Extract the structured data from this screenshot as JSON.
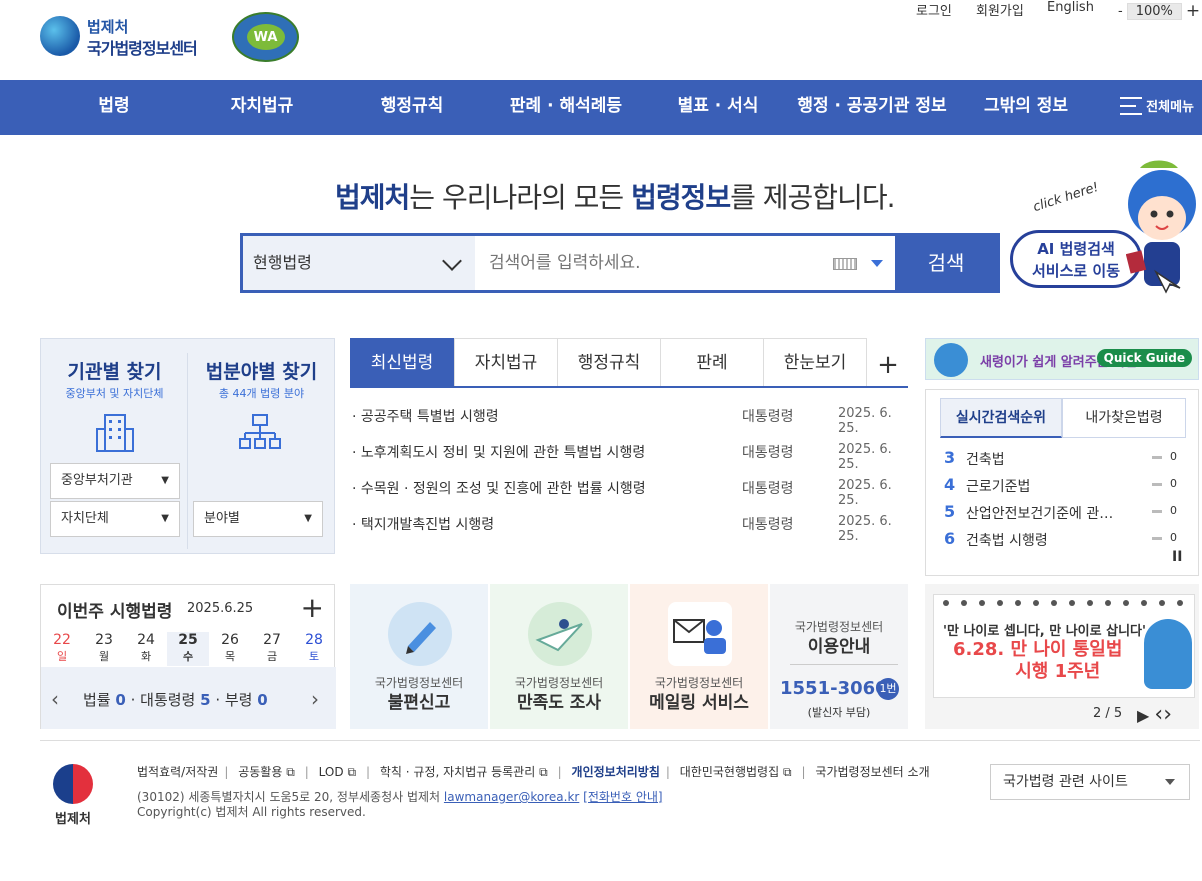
{
  "header": {
    "logo_small": "법제처",
    "logo_main": "국가법령정보센터",
    "wa_mark": "WA",
    "util": {
      "login": "로그인",
      "join": "회원가입",
      "english": "English"
    },
    "zoom": {
      "minus": "-",
      "value": "100%",
      "plus": "+"
    }
  },
  "nav": {
    "items": [
      "법령",
      "자치법규",
      "행정규칙",
      "판례 · 해석례등",
      "별표 · 서식",
      "행정 · 공공기관 정보",
      "그밖의 정보"
    ],
    "all_menu": "전체메뉴"
  },
  "hero": {
    "title_b1": "법제처",
    "title_m1": "는 우리나라의 모든 ",
    "title_b2": "법령정보",
    "title_m2": "를 제공합니다.",
    "search": {
      "select_value": "현행법령",
      "placeholder": "검색어를 입력하세요.",
      "button": "검색"
    },
    "ai_line1": "AI 법령검색",
    "ai_line2": "서비스로 이동",
    "click_here": "click here!"
  },
  "finder": {
    "org": {
      "title": "기관별 찾기",
      "sub": "중앙부처 및 자치단체",
      "dd1": "중앙부처기관",
      "dd2": "자치단체"
    },
    "field": {
      "title": "법분야별 찾기",
      "sub": "총 44개 법령 분야",
      "dd1": "분야별"
    }
  },
  "tabs": {
    "items": [
      "최신법령",
      "자치법규",
      "행정규칙",
      "판례",
      "한눈보기"
    ],
    "active": 0,
    "plus": "+"
  },
  "news": [
    {
      "title": "· 공공주택 특별법 시행령",
      "category": "대통령령",
      "date": "2025. 6. 25."
    },
    {
      "title": "· 노후계획도시 정비 및 지원에 관한 특별법 시행령",
      "category": "대통령령",
      "date": "2025. 6. 25."
    },
    {
      "title": "· 수목원 · 정원의 조성 및 진흥에 관한 법률 시행령",
      "category": "대통령령",
      "date": "2025. 6. 25."
    },
    {
      "title": "· 택지개발촉진법 시행령",
      "category": "대통령령",
      "date": "2025. 6. 25."
    }
  ],
  "quick_guide": {
    "text": "새령이가 쉽게 알려주는 국법",
    "pill": "Quick Guide"
  },
  "rank": {
    "tabs": [
      "실시간검색순위",
      "내가찾은법령"
    ],
    "items": [
      {
        "n": "3",
        "label": "건축법",
        "change": "0"
      },
      {
        "n": "4",
        "label": "근로기준법",
        "change": "0"
      },
      {
        "n": "5",
        "label": "산업안전보건기준에 관한 규칙",
        "change": "0"
      },
      {
        "n": "6",
        "label": "건축법 시행령",
        "change": "0"
      }
    ],
    "pause": "II"
  },
  "week": {
    "title": "이번주 시행법령",
    "date": "2025.6.25",
    "plus": "+",
    "days": [
      {
        "d": "22",
        "w": "일"
      },
      {
        "d": "23",
        "w": "월"
      },
      {
        "d": "24",
        "w": "화"
      },
      {
        "d": "25",
        "w": "수"
      },
      {
        "d": "26",
        "w": "목"
      },
      {
        "d": "27",
        "w": "금"
      },
      {
        "d": "28",
        "w": "토"
      }
    ],
    "sum": {
      "law_label": "법률",
      "law": "0",
      "dec_label": "대통령령",
      "dec": "5",
      "min_label": "부령",
      "min": "0"
    },
    "prev": "‹",
    "next": "›"
  },
  "cards": [
    {
      "l1": "국가법령정보센터",
      "l2": "불편신고"
    },
    {
      "l1": "국가법령정보센터",
      "l2": "만족도 조사"
    },
    {
      "l1": "국가법령정보센터",
      "l2": "메일링 서비스"
    },
    {
      "l1": "국가법령정보센터",
      "l2": "이용안내",
      "phone": "1551-3060",
      "badge": "1번",
      "note": "(발신자 부담)"
    }
  ],
  "banner": {
    "line1": "'만 나이로 셉니다, 만 나이로 삽니다'",
    "line2": "6.28. 만 나이 통일법",
    "line3": "시행 1주년",
    "page": "2 / 5",
    "play": "▶",
    "prev": "‹",
    "next": "›"
  },
  "footer": {
    "logo": "법제처",
    "links": [
      "법적효력/저작권",
      "공동활용",
      "LOD",
      "학칙 · 규정, 자치법규 등록관리",
      "개인정보처리방침",
      "대한민국현행법령집",
      "국가법령정보센터 소개"
    ],
    "ext": "⧉",
    "address": "(30102) 세종특별자치시 도움5로 20, 정부세종청사 법제처",
    "email": "lawmanager@korea.kr",
    "phone_link": "[전화번호 안내]",
    "copyright": "Copyright(c) 법제처 All rights reserved.",
    "related": "국가법령 관련 사이트"
  },
  "colors": {
    "primary": "#3a5fb7",
    "navy": "#1f3f8a",
    "accent": "#3a6fd7",
    "bg_light": "#edf1f8",
    "sunday": "#e8484a",
    "saturday": "#2c4fd4"
  }
}
